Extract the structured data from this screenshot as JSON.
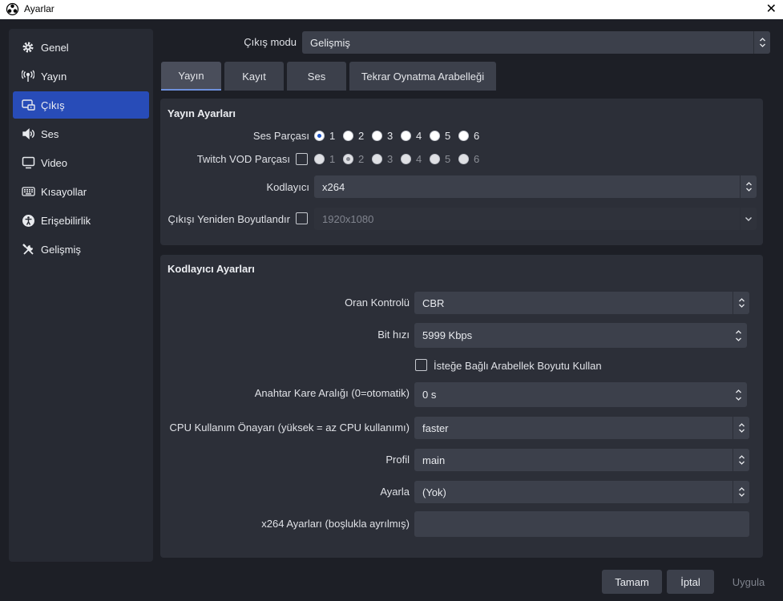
{
  "window": {
    "title": "Ayarlar",
    "close_glyph": "✕"
  },
  "sidebar": {
    "items": [
      {
        "label": "Genel",
        "icon": "gear-icon"
      },
      {
        "label": "Yayın",
        "icon": "broadcast-icon"
      },
      {
        "label": "Çıkış",
        "icon": "output-icon",
        "active": true
      },
      {
        "label": "Ses",
        "icon": "speaker-icon"
      },
      {
        "label": "Video",
        "icon": "monitor-icon"
      },
      {
        "label": "Kısayollar",
        "icon": "keyboard-icon"
      },
      {
        "label": "Erişebilirlik",
        "icon": "accessibility-icon"
      },
      {
        "label": "Gelişmiş",
        "icon": "tools-icon"
      }
    ]
  },
  "output_mode": {
    "label": "Çıkış modu",
    "value": "Gelişmiş"
  },
  "tabs": [
    "Yayın",
    "Kayıt",
    "Ses",
    "Tekrar Oynatma Arabelleği"
  ],
  "stream_settings": {
    "title": "Yayın Ayarları",
    "audio_track_label": "Ses Parçası",
    "audio_tracks": [
      "1",
      "2",
      "3",
      "4",
      "5",
      "6"
    ],
    "audio_track_selected": "1",
    "twitch_vod_label": "Twitch VOD Parçası",
    "twitch_vod_selected": "2",
    "encoder_label": "Kodlayıcı",
    "encoder_value": "x264",
    "rescale_label": "Çıkışı Yeniden Boyutlandır",
    "rescale_value": "1920x1080"
  },
  "encoder_settings": {
    "title": "Kodlayıcı Ayarları",
    "rate_control_label": "Oran Kontrolü",
    "rate_control_value": "CBR",
    "bitrate_label": "Bit hızı",
    "bitrate_value": "5999 Kbps",
    "custom_buffer_label": "İsteğe Bağlı Arabellek Boyutu Kullan",
    "keyframe_label": "Anahtar Kare Aralığı (0=otomatik)",
    "keyframe_value": "0 s",
    "cpu_preset_label": "CPU Kullanım Önayarı (yüksek = az CPU kullanımı)",
    "cpu_preset_value": "faster",
    "profile_label": "Profil",
    "profile_value": "main",
    "tune_label": "Ayarla",
    "tune_value": "(Yok)",
    "x264_options_label": "x264 Ayarları (boşlukla ayrılmış)",
    "x264_options_value": ""
  },
  "buttons": {
    "ok": "Tamam",
    "cancel": "İptal",
    "apply": "Uygula"
  },
  "colors": {
    "accent": "#284cb8",
    "radio_selected": "#1d55c9"
  }
}
